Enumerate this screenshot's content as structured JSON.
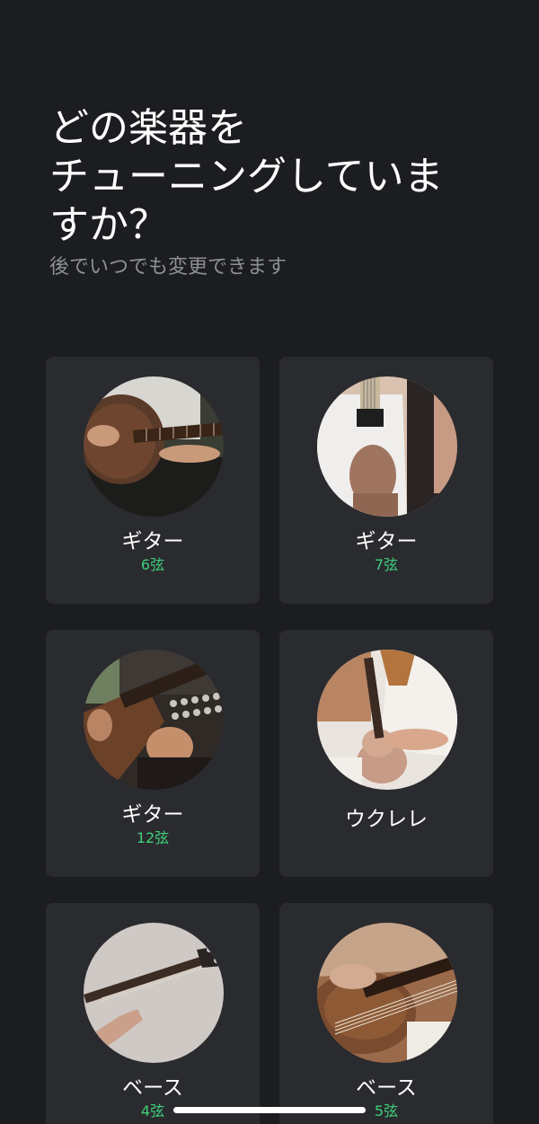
{
  "header": {
    "title_lines": [
      "どの楽器を",
      "チューニングしていま",
      "すか？"
    ],
    "subtitle": "後でいつでも変更できます"
  },
  "instruments": [
    {
      "name": "ギター",
      "strings": "6弦",
      "image": "acoustic-guitar-photo"
    },
    {
      "name": "ギター",
      "strings": "7弦",
      "image": "white-electric-guitar-photo"
    },
    {
      "name": "ギター",
      "strings": "12弦",
      "image": "twelve-string-guitar-photo"
    },
    {
      "name": "ウクレレ",
      "strings": "",
      "image": "ukulele-photo"
    },
    {
      "name": "ベース",
      "strings": "4弦",
      "image": "four-string-bass-photo"
    },
    {
      "name": "ベース",
      "strings": "5弦",
      "image": "five-string-bass-photo"
    }
  ],
  "colors": {
    "background": "#1c1d20",
    "card": "#2a2b2f",
    "accent_green": "#3ecf7a",
    "subtitle_gray": "#8e9096"
  }
}
